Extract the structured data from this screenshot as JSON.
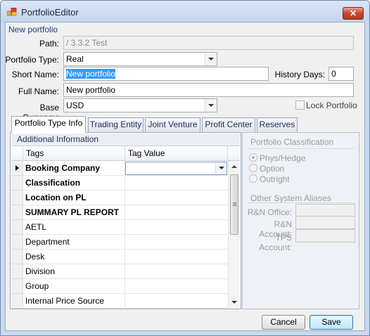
{
  "window": {
    "title": "PortfolioEditor",
    "close_glyph": "✕"
  },
  "form": {
    "group_caption": "New portfolio",
    "path_label": "Path:",
    "path_value": "/ 3.3.2 Test",
    "portfolio_type_label": "Portfolio Type:",
    "portfolio_type_value": "Real",
    "short_name_label": "Short Name:",
    "short_name_value": "New portfolio",
    "history_days_label": "History Days:",
    "history_days_value": "0",
    "full_name_label": "Full Name:",
    "full_name_value": "New portfolio",
    "base_currency_label": "Base Currency:",
    "base_currency_value": "USD",
    "lock_portfolio_label": "Lock Portfolio",
    "lock_portfolio_checked": false
  },
  "tabs": [
    {
      "label": "Portfolio Type Info",
      "active": true
    },
    {
      "label": "Trading Entity",
      "active": false
    },
    {
      "label": "Joint Venture",
      "active": false
    },
    {
      "label": "Profit Center",
      "active": false
    },
    {
      "label": "Reserves",
      "active": false
    }
  ],
  "additional_info": {
    "header": "Additional Information",
    "columns": [
      "Tags",
      "Tag Value"
    ],
    "rows": [
      {
        "tag": "Booking Company",
        "value": "",
        "bold": true,
        "current": true
      },
      {
        "tag": "Classification",
        "value": "",
        "bold": true
      },
      {
        "tag": "Location on PL",
        "value": "",
        "bold": true
      },
      {
        "tag": "SUMMARY PL REPORT",
        "value": "",
        "bold": true
      },
      {
        "tag": "AETL",
        "value": "",
        "bold": false
      },
      {
        "tag": "Department",
        "value": "",
        "bold": false
      },
      {
        "tag": "Desk",
        "value": "",
        "bold": false
      },
      {
        "tag": "Division",
        "value": "",
        "bold": false
      },
      {
        "tag": "Group",
        "value": "",
        "bold": false
      },
      {
        "tag": "Internal Price Source",
        "value": "",
        "bold": false
      }
    ]
  },
  "side_panel": {
    "classification_caption": "Portfolio Classification",
    "options": [
      {
        "label": "Phys/Hedge",
        "selected": true
      },
      {
        "label": "Option",
        "selected": false
      },
      {
        "label": "Outright",
        "selected": false
      }
    ],
    "aliases_caption": "Other System Aliases",
    "aliases": [
      {
        "label": "R&N Office:",
        "value": ""
      },
      {
        "label": "R&N Account:",
        "value": ""
      },
      {
        "label": "TPS Account:",
        "value": ""
      }
    ]
  },
  "buttons": {
    "cancel": "Cancel",
    "save": "Save"
  },
  "colors": {
    "selection": "#3399ff",
    "frame": "#c9d9ef",
    "caption": "#1e3d73"
  }
}
